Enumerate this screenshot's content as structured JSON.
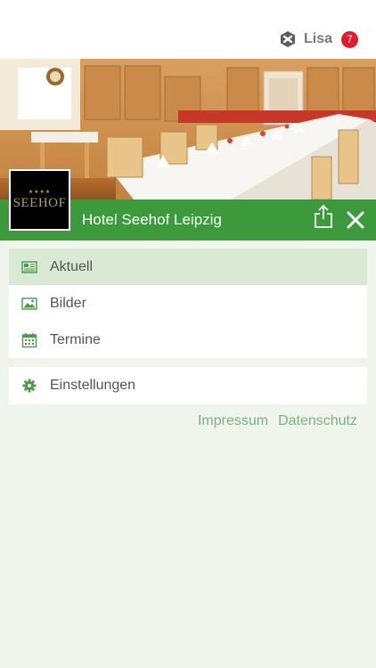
{
  "header": {
    "user_name": "Lisa",
    "notification_count": "7",
    "app_icon": "hex-nut-icon"
  },
  "hotel": {
    "name": "Hotel Seehof Leipzig",
    "logo_text": "SEEHOF",
    "logo_stars": "★★★★"
  },
  "actions": {
    "share_icon": "share-icon",
    "close_icon": "close-icon"
  },
  "menu": {
    "items": [
      {
        "label": "Aktuell",
        "icon": "newspaper-icon",
        "active": true
      },
      {
        "label": "Bilder",
        "icon": "image-icon",
        "active": false
      },
      {
        "label": "Termine",
        "icon": "calendar-icon",
        "active": false
      }
    ]
  },
  "settings": {
    "label": "Einstellungen",
    "icon": "gear-icon"
  },
  "footer_links": {
    "impressum": "Impressum",
    "datenschutz": "Datenschutz"
  },
  "colors": {
    "brand_green": "#3c9a3c",
    "active_item_bg": "#d9e9d4",
    "page_bg": "#eff5ec",
    "badge_red": "#e21c2a",
    "link_green": "#7db07d"
  }
}
